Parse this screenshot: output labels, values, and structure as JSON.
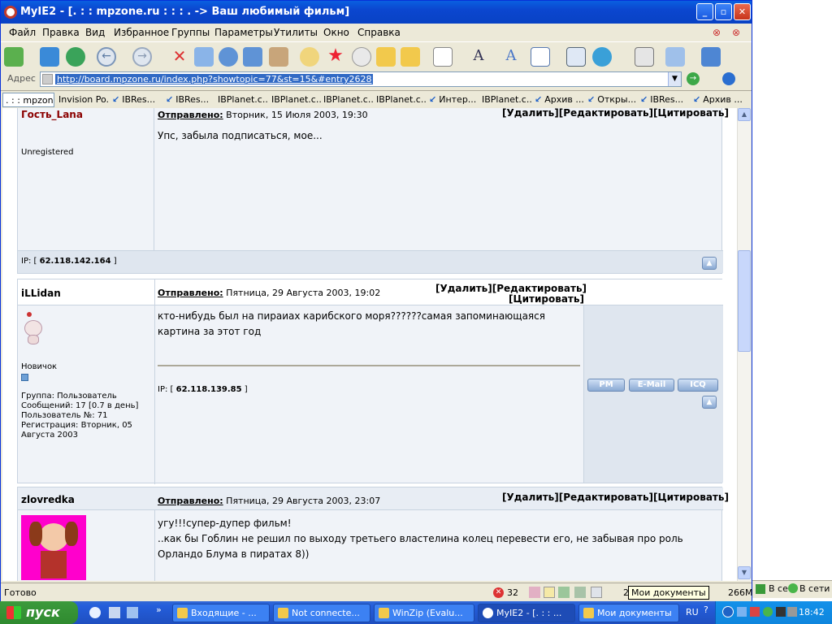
{
  "window": {
    "title": "MyIE2 - [. : : mpzone.ru : : : . -> Ваш любимый фильм]"
  },
  "menu": [
    "Файл",
    "Правка",
    "Вид",
    "Избранное",
    "Группы",
    "Параметры",
    "Утилиты",
    "Окно",
    "Справка"
  ],
  "address": {
    "label": "Адрес",
    "url": "http://board.mpzone.ru/index.php?showtopic=77&st=15&#entry2628"
  },
  "tabs": [
    ". : : mpzon...",
    "Invision Po...",
    "IBRes...",
    "IBRes...",
    "IBPlanet.c...",
    "IBPlanet.c...",
    "IBPlanet.c...",
    "IBPlanet.c...",
    "Интер...",
    "IBPlanet.c...",
    "Архив ...",
    "Откры...",
    "IBRes...",
    "Архив ..."
  ],
  "posts": [
    {
      "author": "Гость_Lana",
      "posted_label": "Отправлено:",
      "date": "Вторник, 15 Июля 2003, 19:30",
      "actions": "[Удалить][Редактировать][Цитировать]",
      "text": "Упс, забыла подписаться, мое...",
      "status": "Unregistered",
      "ip_label": "IP: [",
      "ip": "62.118.142.164",
      "ip_end": "]"
    },
    {
      "author": "iLLidan",
      "posted_label": "Отправлено:",
      "date": "Пятница, 29 Августа 2003, 19:02",
      "actions_line1": "[Удалить][Редактировать]",
      "actions_line2": "[Цитировать]",
      "text": "кто-нибудь был на пираиах карибского моря??????самая запоминающаяся картина за этот год",
      "rank": "Новичок",
      "group": "Группа: Пользователь",
      "posts_count": "Сообщений: 17 [0.7 в день]",
      "user_no": "Пользователь №: 71",
      "registered": "Регистрация: Вторник, 05 Августа 2003",
      "ip_label": "IP: [",
      "ip": "62.118.139.85",
      "ip_end": "]",
      "buttons": [
        "PM",
        "E-Mail",
        "ICQ"
      ]
    },
    {
      "author": "zlovredka",
      "posted_label": "Отправлено:",
      "date": "Пятница, 29 Августа 2003, 23:07",
      "actions": "[Удалить][Редактировать][Цитировать]",
      "line1": "угу!!!супер-дупер фильм!",
      "line2": "..как бы Гоблин не решил по выходу третьего властелина колец перевести его, не забывая про роль Орландо Блума в пиратах 8))"
    }
  ],
  "status": {
    "text": "Готово",
    "count": "32",
    "memory": "266M",
    "page_num": "2",
    "tooltip": "Мои документы"
  },
  "right_status": [
    "В се",
    "В сети"
  ],
  "taskbar": {
    "start": "пуск",
    "tasks": [
      "Входящие - ...",
      "Not connecte...",
      "WinZip (Evalu...",
      "MyIE2 - [. : : ...",
      "Мои документы"
    ],
    "lang": "RU",
    "clock": "18:42"
  },
  "colors": {
    "title_blue": "#0b46cf",
    "forum_row": "#e8edf4",
    "forum_row_alt": "#f0f3f8",
    "author_red": "#8b0000"
  }
}
